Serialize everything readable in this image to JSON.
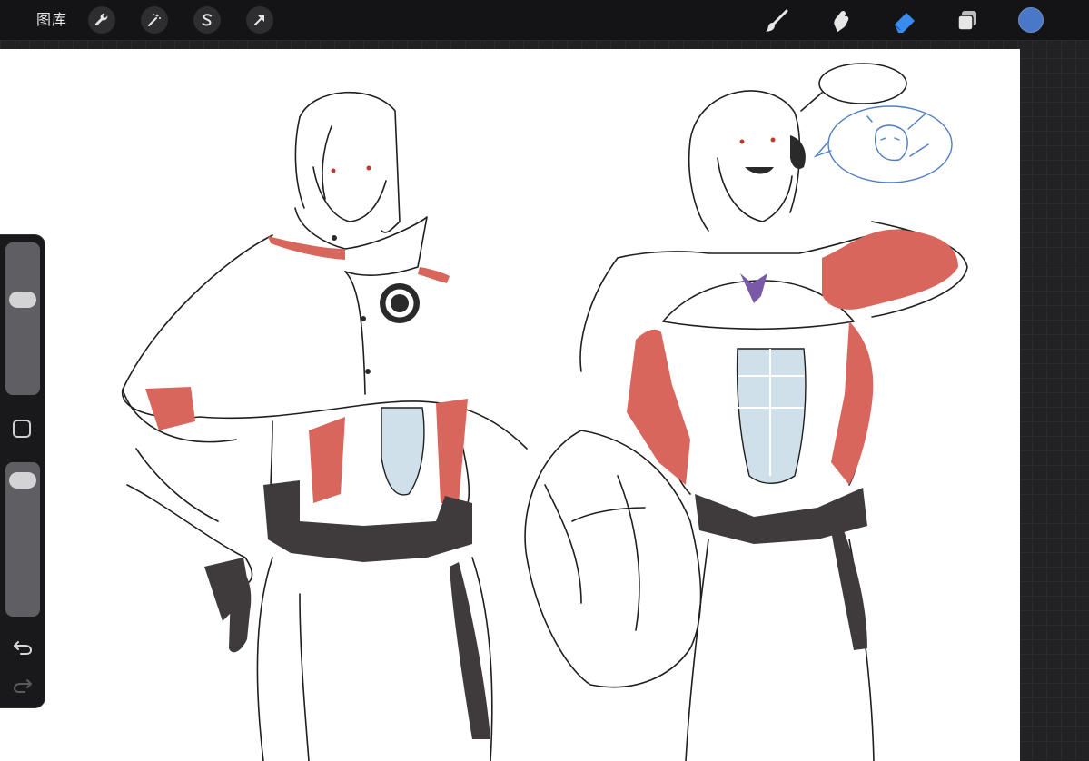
{
  "app": {
    "gallery_label": "图库"
  },
  "toolbar": {
    "left_tools": [
      {
        "icon": "wrench-icon",
        "name": "actions"
      },
      {
        "icon": "magic-wand-icon",
        "name": "adjustments"
      },
      {
        "icon": "selection-s-icon",
        "name": "selection"
      },
      {
        "icon": "arrow-cursor-icon",
        "name": "transform"
      }
    ],
    "right_tools": [
      {
        "icon": "brush-icon",
        "name": "brush"
      },
      {
        "icon": "smudge-icon",
        "name": "smudge"
      },
      {
        "icon": "eraser-icon",
        "name": "eraser",
        "active": true
      },
      {
        "icon": "layers-icon",
        "name": "layers"
      }
    ],
    "active_color": "#4a78c8",
    "active_tool_color": "#3a8bf0"
  },
  "sidebar": {
    "brush_size_level": 0.65,
    "opacity_level": 0.95,
    "icons": [
      "undo-icon",
      "redo-icon"
    ]
  },
  "artwork": {
    "accent_colors": {
      "red": "#d9665c",
      "blue": "#cfe0ea",
      "belt": "#3f3b3d",
      "purple": "#7a5aa8",
      "sketch_blue": "#4f7fc2"
    }
  }
}
